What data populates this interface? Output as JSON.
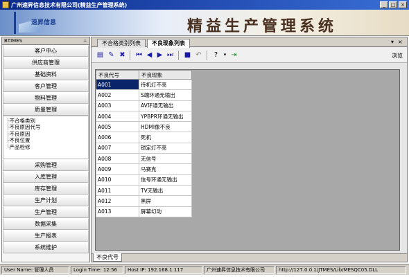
{
  "window": {
    "title": "广州速昇信息技术有限公司(精益生产管理系统)"
  },
  "banner": {
    "logo_text": "速昇信息",
    "app_title": "精益生产管理系统"
  },
  "sidebar": {
    "header": "BTIMES",
    "pin_icon": "pin-icon",
    "top_items": [
      {
        "label": "客户中心"
      },
      {
        "label": "供应商管理"
      },
      {
        "label": "基础资料"
      },
      {
        "label": "客户管理"
      },
      {
        "label": "物料管理"
      },
      {
        "label": "质量管理"
      }
    ],
    "tree": [
      {
        "label": "不合格类别"
      },
      {
        "label": "不良原因代号"
      },
      {
        "label": "不良原因"
      },
      {
        "label": "不良位置"
      },
      {
        "label": "产品检修"
      }
    ],
    "bottom_items": [
      {
        "label": "采购管理"
      },
      {
        "label": "入库管理"
      },
      {
        "label": "库存管理"
      },
      {
        "label": "生产计划"
      },
      {
        "label": "生产管理"
      },
      {
        "label": "数据采集"
      },
      {
        "label": "生产报表"
      },
      {
        "label": "系统维护"
      }
    ]
  },
  "tabs": [
    {
      "label": "不合格类别列表"
    },
    {
      "label": "不良现象列表",
      "active": true
    }
  ],
  "toolbar": {
    "icons": [
      "new-icon",
      "edit-icon",
      "delete-icon",
      "first-record-icon",
      "prev-record-icon",
      "next-record-icon",
      "last-record-icon",
      "save-icon",
      "undo-icon",
      "help-icon",
      "exit-icon"
    ],
    "browse_label": "浏览"
  },
  "table": {
    "columns": [
      "不良代号",
      "不良现象"
    ],
    "rows": [
      [
        "A001",
        "待机灯不亮"
      ],
      [
        "A002",
        "S端环通无输出"
      ],
      [
        "A003",
        "AV环通无输出"
      ],
      [
        "A004",
        "YPBPR环通无输出"
      ],
      [
        "A005",
        "HDMI像不良"
      ],
      [
        "A006",
        "死机"
      ],
      [
        "A007",
        "锁定灯不亮"
      ],
      [
        "A008",
        "无信号"
      ],
      [
        "A009",
        "马赛克"
      ],
      [
        "A010",
        "信号环通无输出"
      ],
      [
        "A011",
        "TV无输出"
      ],
      [
        "A012",
        "黑屏"
      ],
      [
        "A013",
        "屏幕幻动"
      ]
    ],
    "selected_row": 0
  },
  "bottom_tab": {
    "label": "不良代号"
  },
  "status": {
    "user": "User Name: 管理人员",
    "login_time": "Login Time: 12:56",
    "host_ip": "Host IP: 192.168.1.117",
    "company": "广州速昇信息技术有限公司",
    "url": "http://127.0.0.1/JTMES/Lib/MESQC05.DLL"
  },
  "colors": {
    "title_bar": "#0b2a8c",
    "selection": "#0a246a",
    "grid_bg": "#a8a8a8"
  }
}
